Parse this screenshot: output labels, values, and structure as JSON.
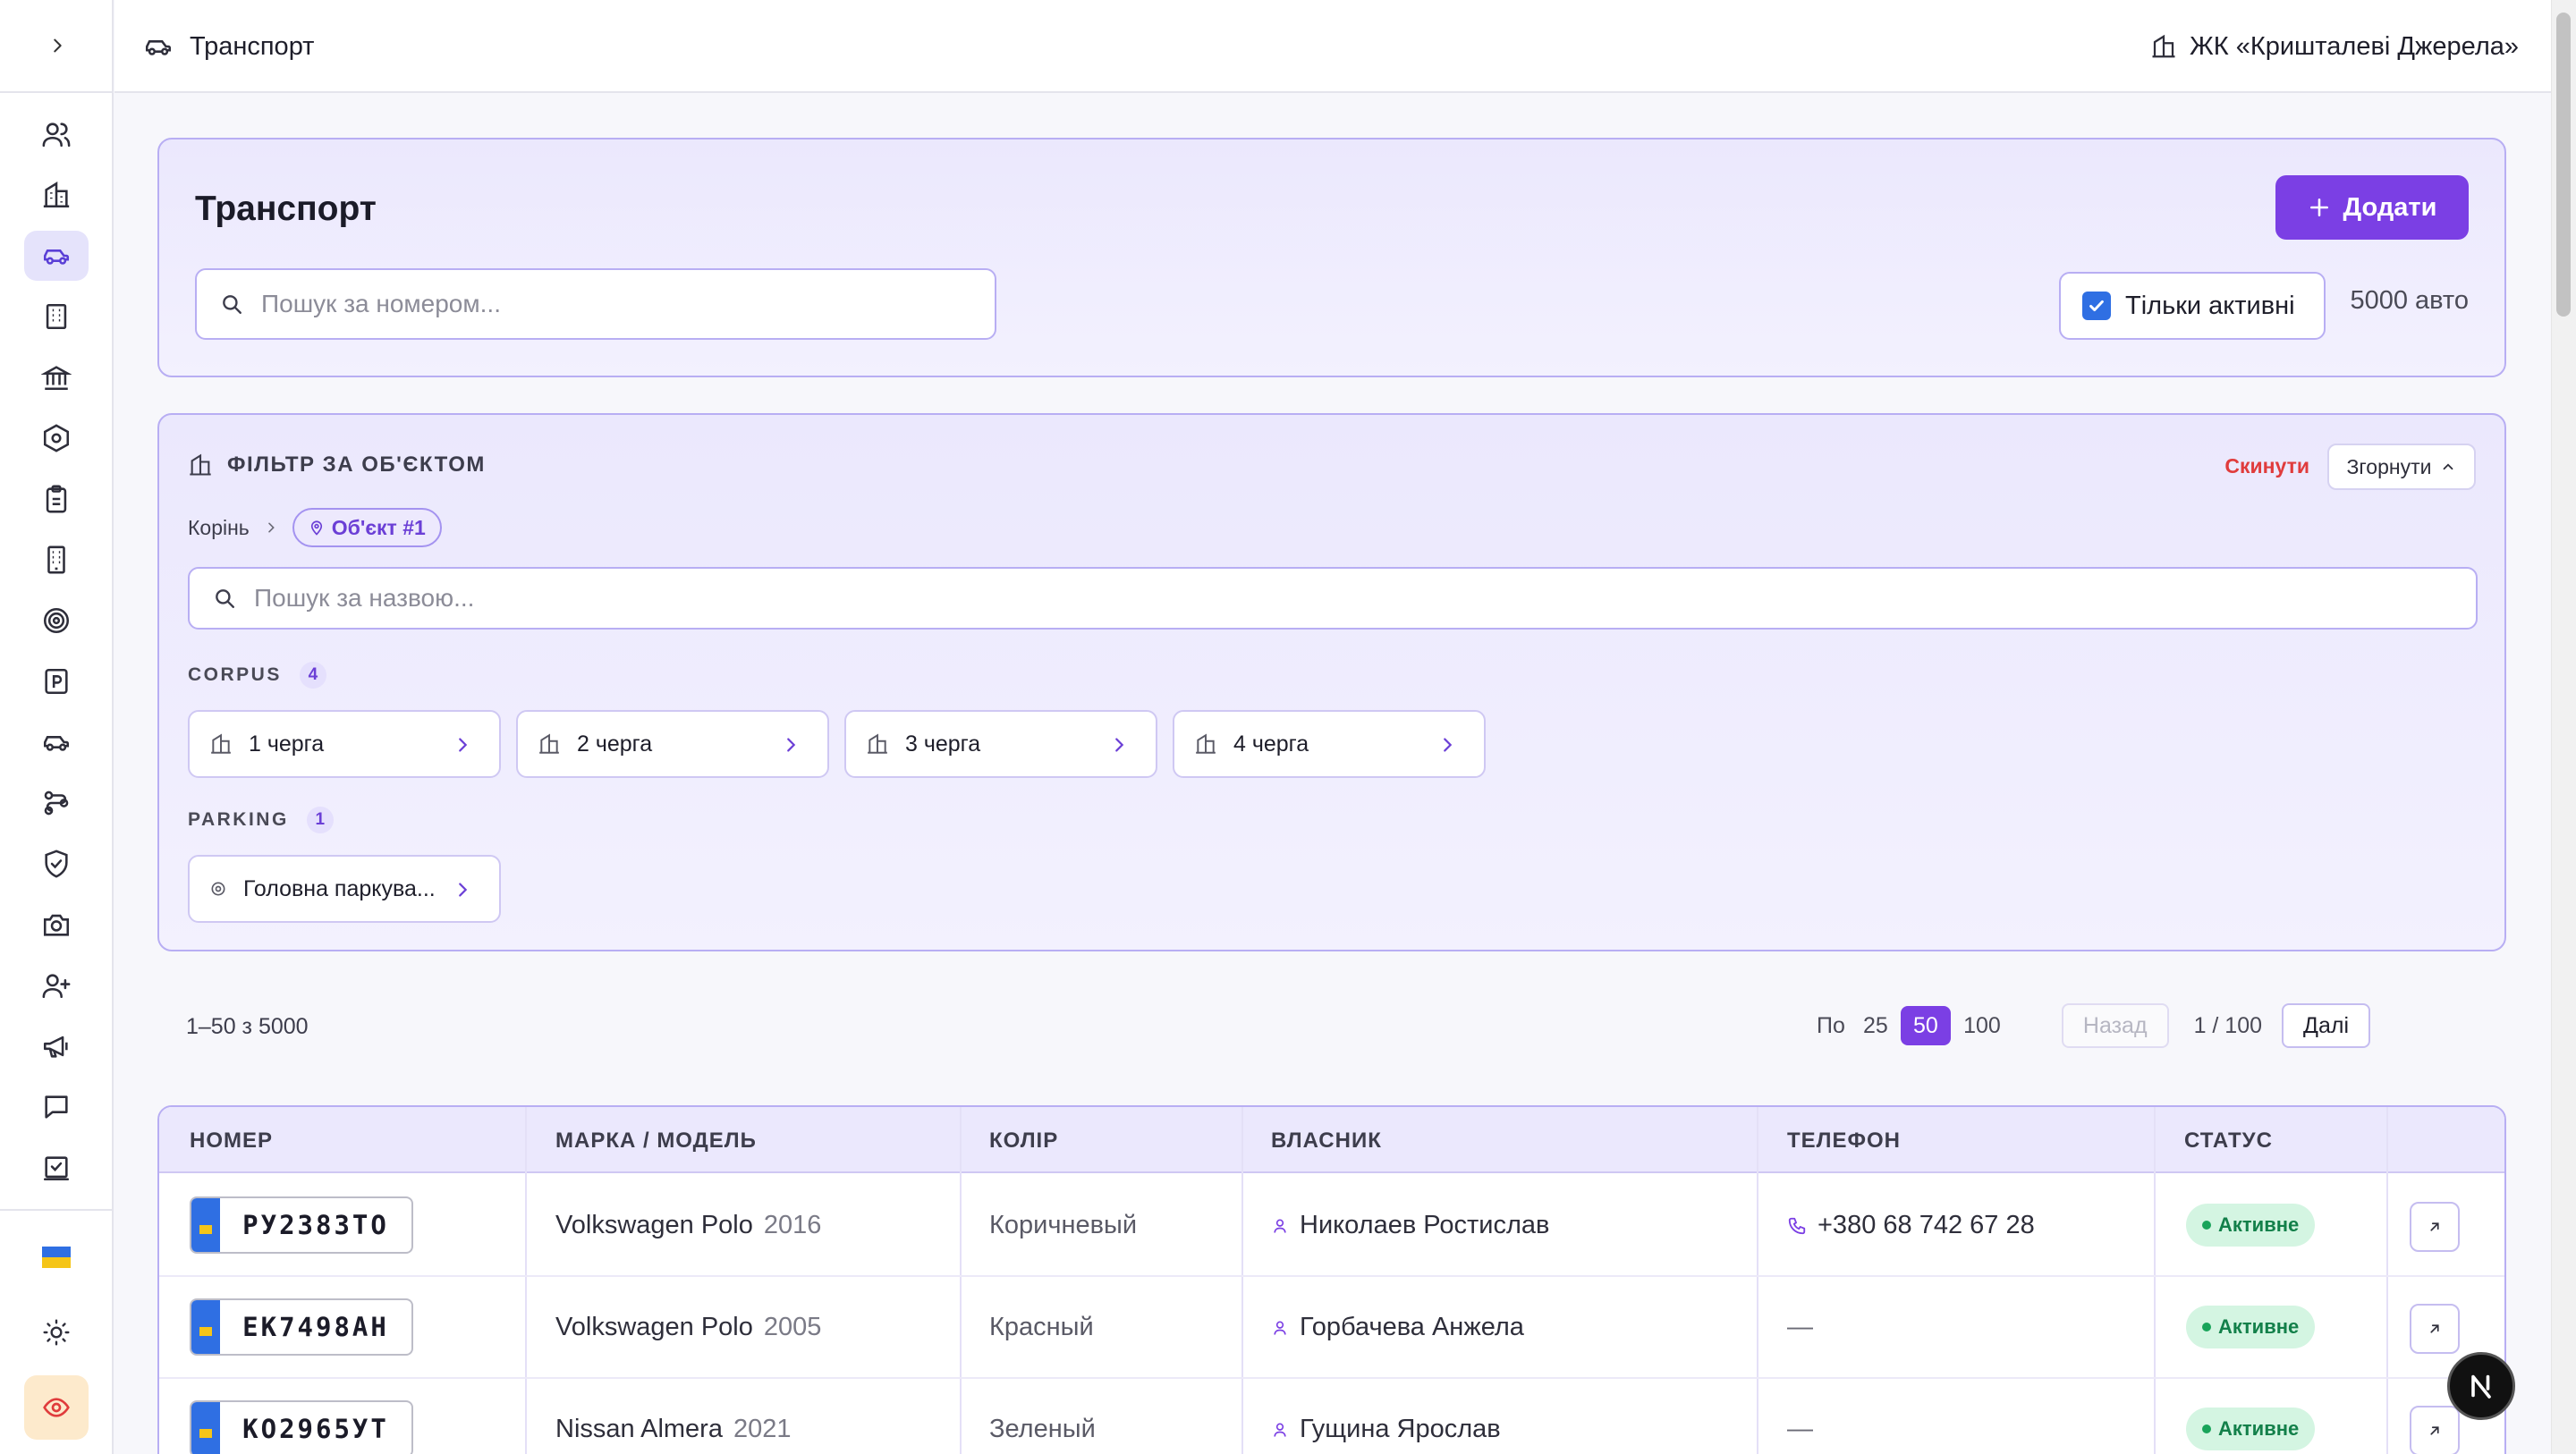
{
  "topbar": {
    "page_title": "Транспорт",
    "complex_name": "ЖК «Кришталеві Джерела»"
  },
  "sidebar": {
    "items": [
      "users-icon",
      "building-icon",
      "car-icon",
      "office-icon",
      "bank-icon",
      "hexagon-icon",
      "clipboard-icon",
      "tower-icon",
      "target-icon",
      "parking-icon",
      "car-icon",
      "route-icon",
      "shield-check-icon",
      "camera-icon",
      "user-plus-icon",
      "megaphone-icon",
      "message-icon",
      "task-icon"
    ],
    "active_index": 2,
    "bottom": [
      "ua-flag-icon",
      "sun-icon",
      "eye-icon"
    ]
  },
  "header": {
    "title": "Транспорт",
    "add_label": "Додати",
    "search_placeholder": "Пошук за номером...",
    "only_active_label": "Тільки активні",
    "only_active_checked": true,
    "count_label": "5000 авто"
  },
  "filter": {
    "title": "ФІЛЬТР ЗА ОБ'ЄКТОМ",
    "reset_label": "Скинути",
    "collapse_label": "Згорнути",
    "breadcrumb_root": "Корінь",
    "breadcrumb_current": "Об'єкт #1",
    "search_placeholder": "Пошук за назвою...",
    "groups": [
      {
        "name": "CORPUS",
        "count": "4",
        "items": [
          "1 черга",
          "2 черга",
          "3 черга",
          "4 черга"
        ]
      },
      {
        "name": "PARKING",
        "count": "1",
        "items": [
          "Головна паркува..."
        ]
      }
    ]
  },
  "pagination": {
    "range": "1–50 з 5000",
    "per_label": "По",
    "sizes": [
      "25",
      "50",
      "100"
    ],
    "selected_size": "50",
    "prev_label": "Назад",
    "page_label": "1 / 100",
    "next_label": "Далі"
  },
  "table": {
    "columns": [
      "НОМЕР",
      "МАРКА / МОДЕЛЬ",
      "КОЛІР",
      "ВЛАСНИК",
      "ТЕЛЕФОН",
      "СТАТУС"
    ],
    "rows": [
      {
        "plate": "РУ2383ТО",
        "model": "Volkswagen Polo",
        "year": "2016",
        "color": "Коричневый",
        "owner": "Николаев Ростислав",
        "phone": "+380 68 742 67 28",
        "status": "Активне"
      },
      {
        "plate": "ЕК7498АН",
        "model": "Volkswagen Polo",
        "year": "2005",
        "color": "Красный",
        "owner": "Горбачева Анжела",
        "phone": "—",
        "status": "Активне"
      },
      {
        "plate": "КО2965УТ",
        "model": "Nissan Almera",
        "year": "2021",
        "color": "Зеленый",
        "owner": "Гущина Ярослав",
        "phone": "—",
        "status": "Активне"
      }
    ]
  },
  "colors": {
    "accent": "#7b3fe4",
    "status_green": "#13804a",
    "danger": "#e03c3c"
  }
}
